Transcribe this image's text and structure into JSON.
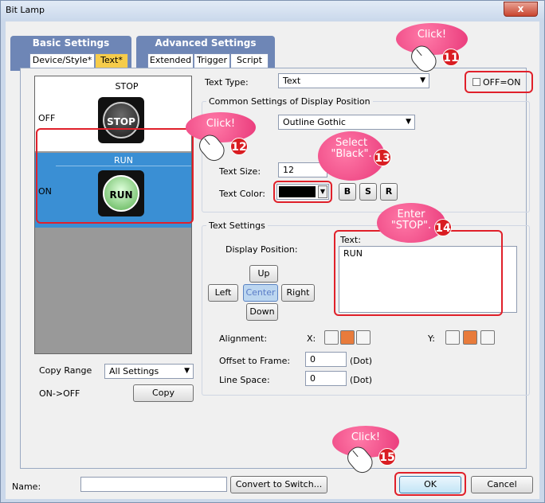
{
  "window": {
    "title": "Bit Lamp",
    "close": "x"
  },
  "tabs": {
    "basic": "Basic Settings",
    "advanced": "Advanced Settings",
    "device_style": "Device/Style*",
    "text": "Text*",
    "extended": "Extended",
    "trigger": "Trigger",
    "script": "Script"
  },
  "preview": {
    "off_label": "OFF",
    "on_label": "ON",
    "off_text": "STOP",
    "on_text": "RUN",
    "off_lamp": "STOP",
    "on_lamp": "RUN"
  },
  "text_type": {
    "label": "Text Type:",
    "value": "Text"
  },
  "off_on": {
    "label": "OFF=ON",
    "checked": false
  },
  "common": {
    "title": "Common Settings of Display Position",
    "font": "Outline Gothic",
    "size_label": "Text Size:",
    "size_value": "12",
    "color_label": "Text Color:",
    "bold": "B",
    "shadow": "S",
    "raised": "R"
  },
  "text_settings": {
    "title": "Text Settings",
    "display_position": "Display Position:",
    "text_label": "Text:",
    "text_value": "RUN",
    "up": "Up",
    "left": "Left",
    "center": "Center",
    "right": "Right",
    "down": "Down",
    "alignment": "Alignment:",
    "x": "X:",
    "y": "Y:",
    "offset_label": "Offset to Frame:",
    "offset_value": "0",
    "offset_unit": "(Dot)",
    "line_space_label": "Line Space:",
    "line_space_value": "0",
    "line_space_unit": "(Dot)"
  },
  "copy": {
    "range_label": "Copy Range",
    "range_value": "All Settings",
    "direction": "ON->OFF",
    "button": "Copy"
  },
  "footer": {
    "name_label": "Name:",
    "name_value": "",
    "convert": "Convert to Switch...",
    "ok": "OK",
    "cancel": "Cancel"
  },
  "callouts": {
    "c11": "Click!",
    "n11": "11",
    "c12": "Click!",
    "n12": "12",
    "c13": "Select \"Black\".",
    "n13": "13",
    "c14": "Enter \"STOP\".",
    "n14": "14",
    "c15": "Click!",
    "n15": "15"
  }
}
